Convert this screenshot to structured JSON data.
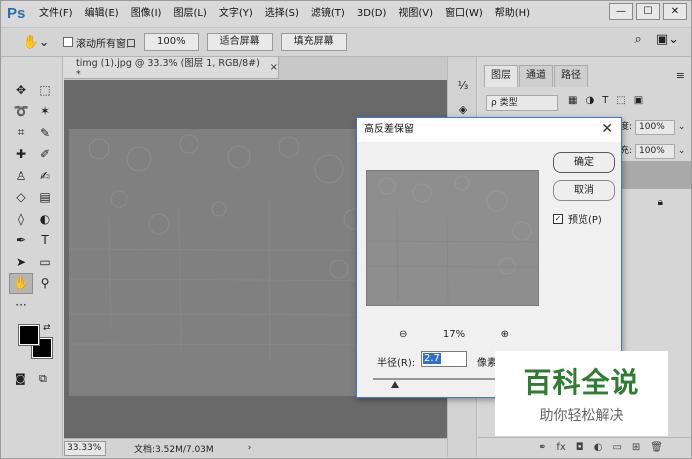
{
  "app": {
    "logo": "Ps"
  },
  "menu": [
    "文件(F)",
    "编辑(E)",
    "图像(I)",
    "图层(L)",
    "文字(Y)",
    "选择(S)",
    "滤镜(T)",
    "3D(D)",
    "视图(V)",
    "窗口(W)",
    "帮助(H)"
  ],
  "window_controls": {
    "minimize": "—",
    "maximize": "☐",
    "close": "✕"
  },
  "options": {
    "scroll_all_label": "滚动所有窗口",
    "zoom_button": "100%",
    "fit_button": "适合屏幕",
    "fill_button": "填充屏幕"
  },
  "document": {
    "tab_title": "timg (1).jpg @ 33.3% (图层 1, RGB/8#) *",
    "tab_close": "×",
    "zoom": "33.33%",
    "doc_size": "文档:3.52M/7.03M",
    "status_arrow": "›"
  },
  "panel": {
    "tabs": [
      "图层",
      "通道",
      "路径"
    ],
    "filter_placeholder": "ρ 类型",
    "opacity_label": "度:",
    "opacity_value": "100%",
    "fill_label": "充:",
    "fill_value": "100%"
  },
  "dialog": {
    "title": "高反差保留",
    "close": "✕",
    "ok": "确定",
    "cancel": "取消",
    "preview_label": "预览(P)",
    "preview_checked": true,
    "zoom_percent": "17%",
    "radius_label": "半径(R):",
    "radius_value": "2.7",
    "radius_unit": "像素"
  },
  "watermark": {
    "title": "百科全说",
    "subtitle": "助你轻松解决"
  }
}
